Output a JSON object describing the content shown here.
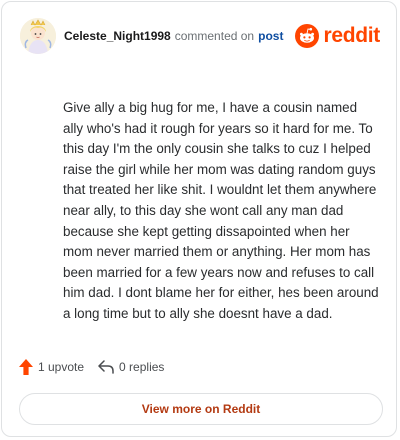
{
  "comment": {
    "username": "Celeste_Night1998",
    "action_text": "commented on",
    "post_link": "post",
    "body": "Give ally a big hug for me, I have a cousin named ally who's had it rough for years so it hard for me. To this day I'm the only cousin she talks to cuz I helped raise the girl while her mom was dating random guys that treated her like shit. I wouldnt let them anywhere near ally, to this day she wont call any man dad because she kept getting dissapointed when her mom never married them or anything. Her mom has been married for a few years now and refuses to call him dad. I dont blame her for either, hes been around a long time but to ally she doesnt have a dad."
  },
  "brand": {
    "wordmark": "reddit",
    "color": "#ff4500"
  },
  "actions": {
    "upvote_label": "1 upvote",
    "upvote_icon": "upvote-arrow-icon",
    "upvote_color": "#ff4500",
    "reply_label": "0 replies",
    "reply_icon": "reply-arrow-icon"
  },
  "footer": {
    "view_more_label": "View more on Reddit"
  }
}
